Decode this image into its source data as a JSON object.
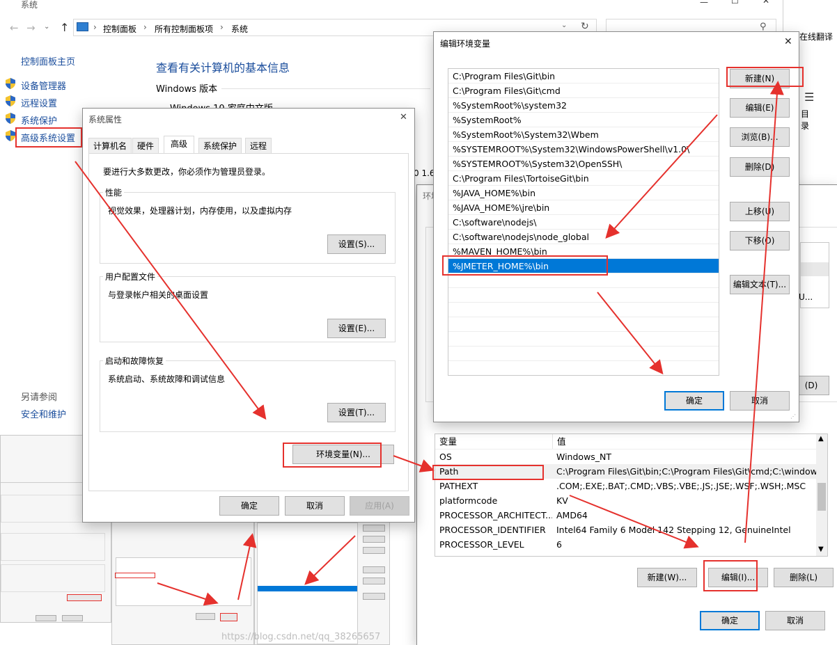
{
  "system_window": {
    "title": "系统",
    "breadcrumb": [
      "控制面板",
      "所有控制面板项",
      "系统"
    ],
    "right_clip": "在线翻译",
    "right_clip2": "目录",
    "sidebar": {
      "home": "控制面板主页",
      "items": [
        {
          "label": "设备管理器",
          "icon": "shield-icon"
        },
        {
          "label": "远程设置",
          "icon": "shield-icon"
        },
        {
          "label": "系统保护",
          "icon": "shield-icon"
        },
        {
          "label": "高级系统设置",
          "icon": "shield-icon"
        }
      ],
      "see_also": "另请参阅",
      "security": "安全和维护"
    },
    "main_title": "查看有关计算机的基本信息",
    "windows_version": "Windows 版本",
    "windows_edition": "Windows 10 家庭中文版",
    "clip_text": "0 1.6"
  },
  "system_properties": {
    "title": "系统属性",
    "tabs": [
      "计算机名",
      "硬件",
      "高级",
      "系统保护",
      "远程"
    ],
    "admin_note": "要进行大多数更改，你必须作为管理员登录。",
    "performance": {
      "title": "性能",
      "desc": "视觉效果，处理器计划，内存使用，以及虚拟内存",
      "button": "设置(S)..."
    },
    "user_profiles": {
      "title": "用户配置文件",
      "desc": "与登录帐户相关的桌面设置",
      "button": "设置(E)..."
    },
    "startup": {
      "title": "启动和故障恢复",
      "desc": "系统启动、系统故障和调试信息",
      "button": "设置(T)..."
    },
    "env_button": "环境变量(N)...",
    "ok": "确定",
    "cancel": "取消",
    "apply": "应用(A)"
  },
  "env_vars": {
    "title_clip": "环境",
    "system_vars_header": [
      "变量",
      "值"
    ],
    "rows": [
      {
        "name": "OS",
        "value": "Windows_NT"
      },
      {
        "name": "Path",
        "value": "C:\\Program Files\\Git\\bin;C:\\Program Files\\Git\\cmd;C:\\window..."
      },
      {
        "name": "PATHEXT",
        "value": ".COM;.EXE;.BAT;.CMD;.VBS;.VBE;.JS;.JSE;.WSF;.WSH;.MSC"
      },
      {
        "name": "platformcode",
        "value": "KV"
      },
      {
        "name": "PROCESSOR_ARCHITECT...",
        "value": "AMD64"
      },
      {
        "name": "PROCESSOR_IDENTIFIER",
        "value": "Intel64 Family 6 Model 142 Stepping 12, GenuineIntel"
      },
      {
        "name": "PROCESSOR_LEVEL",
        "value": "6"
      }
    ],
    "new": "新建(W)...",
    "edit": "编辑(I)...",
    "delete": "删除(L)",
    "ok": "确定",
    "cancel": "取消",
    "clip_btn": "(D)",
    "clip_u": "U..."
  },
  "edit_env": {
    "title": "编辑环境变量",
    "entries": [
      "C:\\Program Files\\Git\\bin",
      "C:\\Program Files\\Git\\cmd",
      "%SystemRoot%\\system32",
      "%SystemRoot%",
      "%SystemRoot%\\System32\\Wbem",
      "%SYSTEMROOT%\\System32\\WindowsPowerShell\\v1.0\\",
      "%SYSTEMROOT%\\System32\\OpenSSH\\",
      "C:\\Program Files\\TortoiseGit\\bin",
      "%JAVA_HOME%\\bin",
      "%JAVA_HOME%\\jre\\bin",
      "C:\\software\\nodejs\\",
      "C:\\software\\nodejs\\node_global",
      "%MAVEN_HOME%\\bin",
      "%JMETER_HOME%\\bin"
    ],
    "selected_index": 13,
    "buttons": {
      "new": "新建(N)",
      "edit": "编辑(E)",
      "browse": "浏览(B)...",
      "delete": "删除(D)",
      "up": "上移(U)",
      "down": "下移(O)",
      "edit_text": "编辑文本(T)..."
    },
    "ok": "确定",
    "cancel": "取消"
  },
  "watermark": "https://blog.csdn.net/qq_38265657",
  "colors": {
    "accent": "#0078d7",
    "annotation": "#e5312d",
    "link": "#1a4d9c"
  }
}
